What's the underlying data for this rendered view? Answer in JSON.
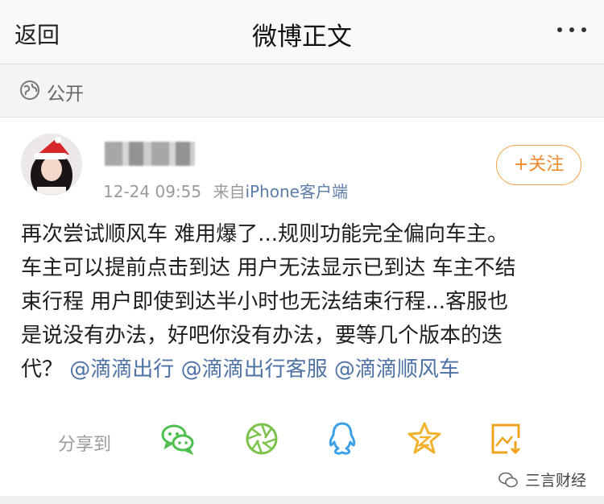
{
  "nav": {
    "back_label": "返回",
    "title": "微博正文",
    "more_icon": "more-dots-icon"
  },
  "visibility": {
    "icon": "globe-icon",
    "label": "公开"
  },
  "post": {
    "timestamp": "12-24 09:55",
    "source_prefix": "来自",
    "source": "iPhone客户端",
    "follow_label": "+关注",
    "content_lines": [
      "再次尝试顺风车 难用爆了...规则功能完全偏向车主。",
      "车主可以提前点击到达 用户无法显示已到达 车主不结",
      "束行程 用户即使到达半小时也无法结束行程...客服也",
      "是说没有办法，好吧你没有办法，要等几个版本的迭"
    ],
    "last_line_prefix": "代？",
    "mentions": [
      "@滴滴出行",
      "@滴滴出行客服",
      "@滴滴顺风车"
    ]
  },
  "share": {
    "label": "分享到",
    "targets": [
      {
        "icon": "wechat-icon",
        "color": "#4cbf4c"
      },
      {
        "icon": "moments-icon",
        "color": "#7cc24a"
      },
      {
        "icon": "qq-icon",
        "color": "#3ba0e8"
      },
      {
        "icon": "qzone-icon",
        "color": "#f2b12c"
      },
      {
        "icon": "save-image-icon",
        "color": "#f0a31c"
      }
    ]
  },
  "watermark": {
    "text": "三言财经"
  },
  "colors": {
    "link": "#4f72a6",
    "follow": "#ee8a2c",
    "meta": "#9a9a9a"
  }
}
